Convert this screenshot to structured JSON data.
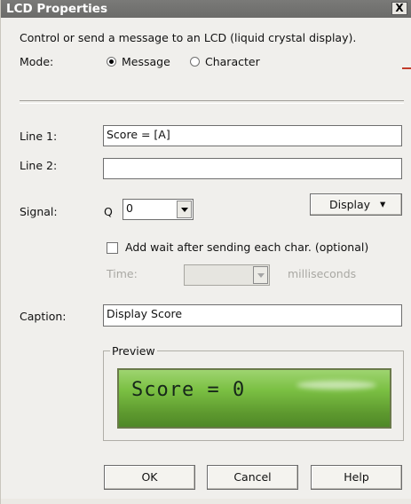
{
  "window": {
    "title": "LCD Properties",
    "close_glyph": "X"
  },
  "description": "Control or send a message to an LCD (liquid crystal display).",
  "mode": {
    "label": "Mode:",
    "options": [
      {
        "label": "Message",
        "selected": true
      },
      {
        "label": "Character",
        "selected": false
      }
    ]
  },
  "line1": {
    "label": "Line 1:",
    "value": "Score = [A]"
  },
  "line2": {
    "label": "Line 2:",
    "value": ""
  },
  "signal": {
    "label": "Signal:",
    "prefix": "Q",
    "value": "0"
  },
  "display_button": {
    "label": "Display",
    "arrow": "▾"
  },
  "add_wait": {
    "label": "Add wait after sending each char. (optional)",
    "checked": false
  },
  "time": {
    "label": "Time:",
    "value": "",
    "unit": "milliseconds"
  },
  "caption": {
    "label": "Caption:",
    "value": "Display Score"
  },
  "preview": {
    "legend": "Preview",
    "lcd_text": "Score = 0"
  },
  "buttons": {
    "ok": "OK",
    "cancel": "Cancel",
    "help": "Help"
  },
  "colors": {
    "title_bar": "#6b6b69",
    "dialog_bg": "#f0efec",
    "lcd_green": "#7bc043",
    "accent": "#c23c2b"
  }
}
